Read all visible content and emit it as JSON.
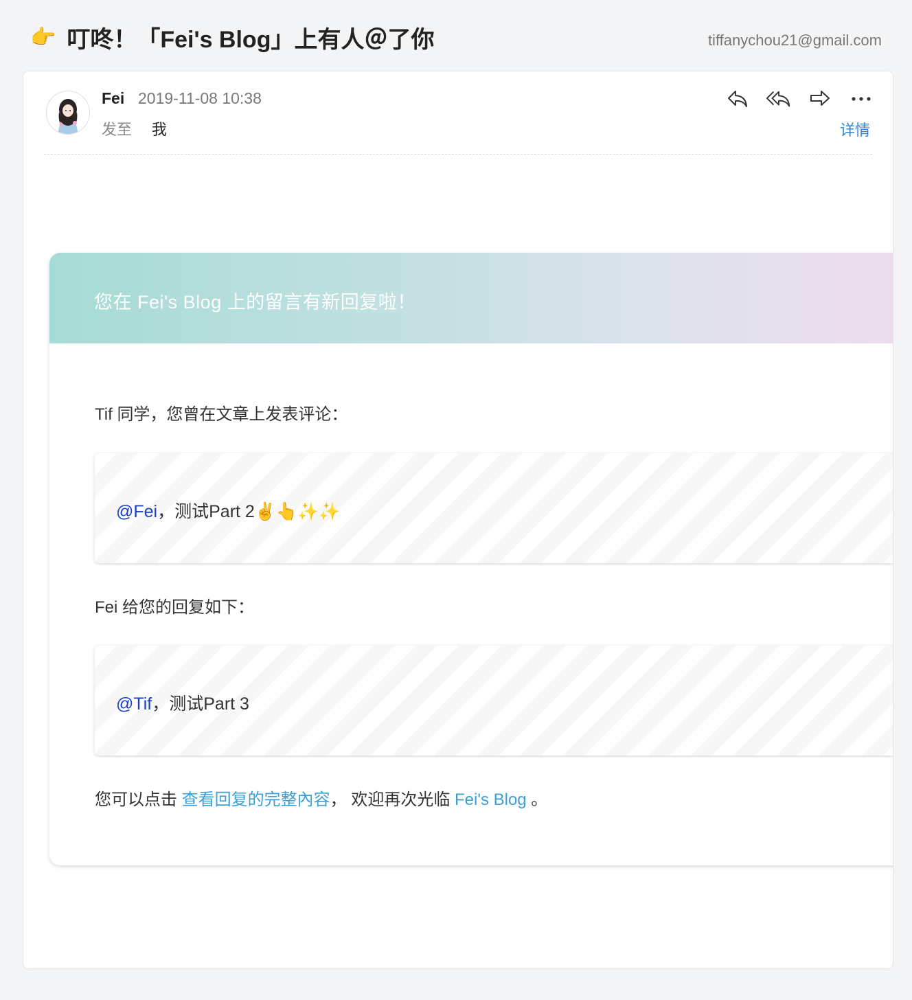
{
  "header": {
    "subject_emoji": "👉",
    "subject": "叮咚！「Fei's Blog」上有人＠了你",
    "account": "tiffanychou21@gmail.com"
  },
  "message": {
    "sender": "Fei",
    "time": "2019-11-08 10:38",
    "to_label": "发至",
    "to_value": "我",
    "detail_label": "详情",
    "actions": [
      "reply-icon",
      "reply-all-icon",
      "forward-icon",
      "more-icon"
    ]
  },
  "notification": {
    "banner_title": "您在 Fei's Blog 上的留言有新回复啦！",
    "intro": "Tif 同学，您曾在文章上发表评论：",
    "comment": {
      "mention": "@Fei",
      "text": "，测试Part 2✌️👆✨✨"
    },
    "reply_intro": "Fei 给您的回复如下：",
    "reply": {
      "mention": "@Tif",
      "text": "，测试Part 3"
    },
    "footer_prefix": "您可以点击 ",
    "footer_link": "查看回复的完整內容",
    "footer_middle": "， 欢迎再次光临 ",
    "footer_blog_link": "Fei's Blog",
    "footer_suffix": " 。"
  },
  "colors": {
    "link": "#3aa0d5",
    "mention": "#1540c8",
    "detail": "#2f86d6"
  }
}
